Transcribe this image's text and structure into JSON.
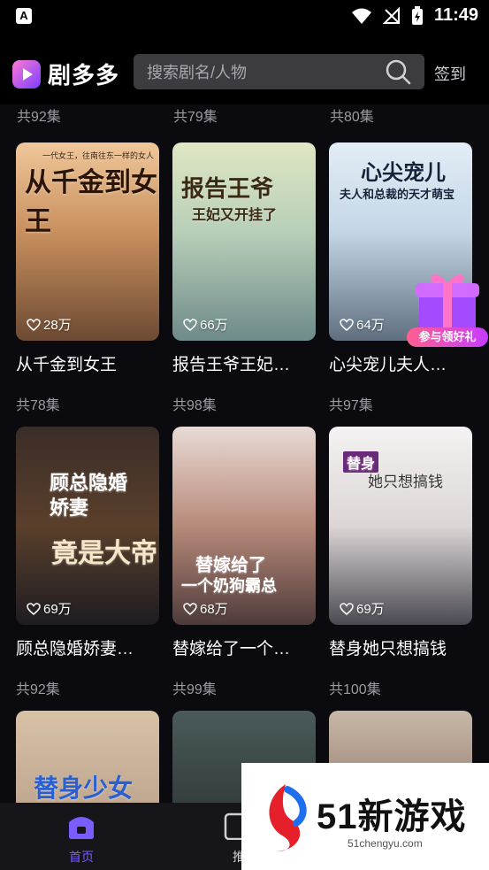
{
  "statusbar": {
    "time": "11:49",
    "notification_icon": "A"
  },
  "header": {
    "app_name": "剧多多",
    "search_placeholder": "搜索剧名/人物",
    "signin_label": "签到"
  },
  "top_row_episodes": [
    "共92集",
    "共79集",
    "共80集"
  ],
  "cards": [
    {
      "title": "从千金到女王",
      "likes": "28万",
      "episodes": "共78集",
      "poster_text": "从千金到女王",
      "poster_sub": "一代女王，往南往东一样的女人"
    },
    {
      "title": "报告王爷王妃…",
      "likes": "66万",
      "episodes": "共98集",
      "poster_text": "报告王爷",
      "poster_sub": "王妃又开挂了"
    },
    {
      "title": "心尖宠儿夫人…",
      "likes": "64万",
      "episodes": "共97集",
      "poster_text": "心尖宠儿",
      "poster_sub": "夫人和总裁的天才萌宝"
    },
    {
      "title": "顾总隐婚娇妻…",
      "likes": "69万",
      "episodes": "共92集",
      "poster_text": "顾总隐婚娇妻",
      "poster_sub": "竟是大帝"
    },
    {
      "title": "替嫁给了一个…",
      "likes": "68万",
      "episodes": "共99集",
      "poster_text": "替嫁给了",
      "poster_sub": "一个奶狗霸总"
    },
    {
      "title": "替身她只想搞钱",
      "likes": "69万",
      "episodes": "共100集",
      "poster_text": "替身",
      "poster_sub": "她只想搞钱"
    },
    {
      "title": "",
      "likes": "",
      "episodes": "",
      "poster_text": "替身少女",
      "poster_sub": ""
    },
    {
      "title": "",
      "likes": "",
      "episodes": "",
      "poster_text": "",
      "poster_sub": ""
    },
    {
      "title": "",
      "likes": "",
      "episodes": "",
      "poster_text": "",
      "poster_sub": ""
    }
  ],
  "gift": {
    "label": "参与领好礼"
  },
  "tabbar": {
    "home_label": "首页",
    "second_label": "推"
  },
  "watermark": {
    "main": "51新游戏",
    "sub": "51chengyu.com"
  },
  "colors": {
    "accent": "#7b5cff",
    "background": "#0b0b0f",
    "tabbar": "#15151a"
  }
}
